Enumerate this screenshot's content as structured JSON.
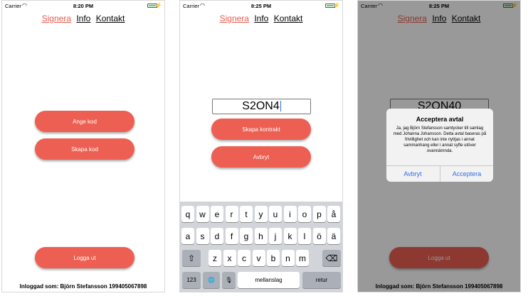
{
  "status": {
    "carrier": "Carrier",
    "wifi_icon": "◠",
    "charge_icon": "⚡",
    "time_1": "8:20 PM",
    "time_2": "8:25 PM",
    "time_3": "8:25 PM"
  },
  "nav": {
    "signera": "Signera",
    "info": "Info",
    "kontakt": "Kontakt"
  },
  "screen1": {
    "ange_kod": "Ange kod",
    "skapa_kod": "Skapa kod",
    "logga_ut": "Logga ut",
    "footer": "Inloggad som: Björn Stefansson 199405067898"
  },
  "screen2": {
    "code_value": "S2ON4",
    "skapa_kontrakt": "Skapa kontrakt",
    "avbryt": "Avbryt",
    "keyboard": {
      "row1": [
        "q",
        "w",
        "e",
        "r",
        "t",
        "y",
        "u",
        "i",
        "o",
        "p",
        "å"
      ],
      "row2": [
        "a",
        "s",
        "d",
        "f",
        "g",
        "h",
        "j",
        "k",
        "l",
        "ö",
        "ä"
      ],
      "row3": [
        "z",
        "x",
        "c",
        "v",
        "b",
        "n",
        "m"
      ],
      "shift": "⇧",
      "delete": "⌫",
      "num": "123",
      "globe": "🌐",
      "mic": "🎙",
      "space": "mellanslag",
      "return": "retur"
    }
  },
  "screen3": {
    "code_value": "S2ON40",
    "alert_title": "Acceptera avtal",
    "alert_message": "Ja, jag Björn Stefansson samtycker till samlag med Johanna Johansson. Detta avtal baseras på frivillighet och kan inte nyttjas i annat sammanhang eller i annat syfte utöver ovannämnda.",
    "alert_cancel": "Avbryt",
    "alert_accept": "Acceptera",
    "logga_ut": "Logga ut",
    "footer": "Inloggad som: Björn Stefansson 199405067898"
  },
  "colors": {
    "accent": "#ec5f52",
    "link_active": "#e95c4f",
    "ios_blue": "#2f6fe0",
    "keyboard_bg": "#d1d4d9"
  }
}
